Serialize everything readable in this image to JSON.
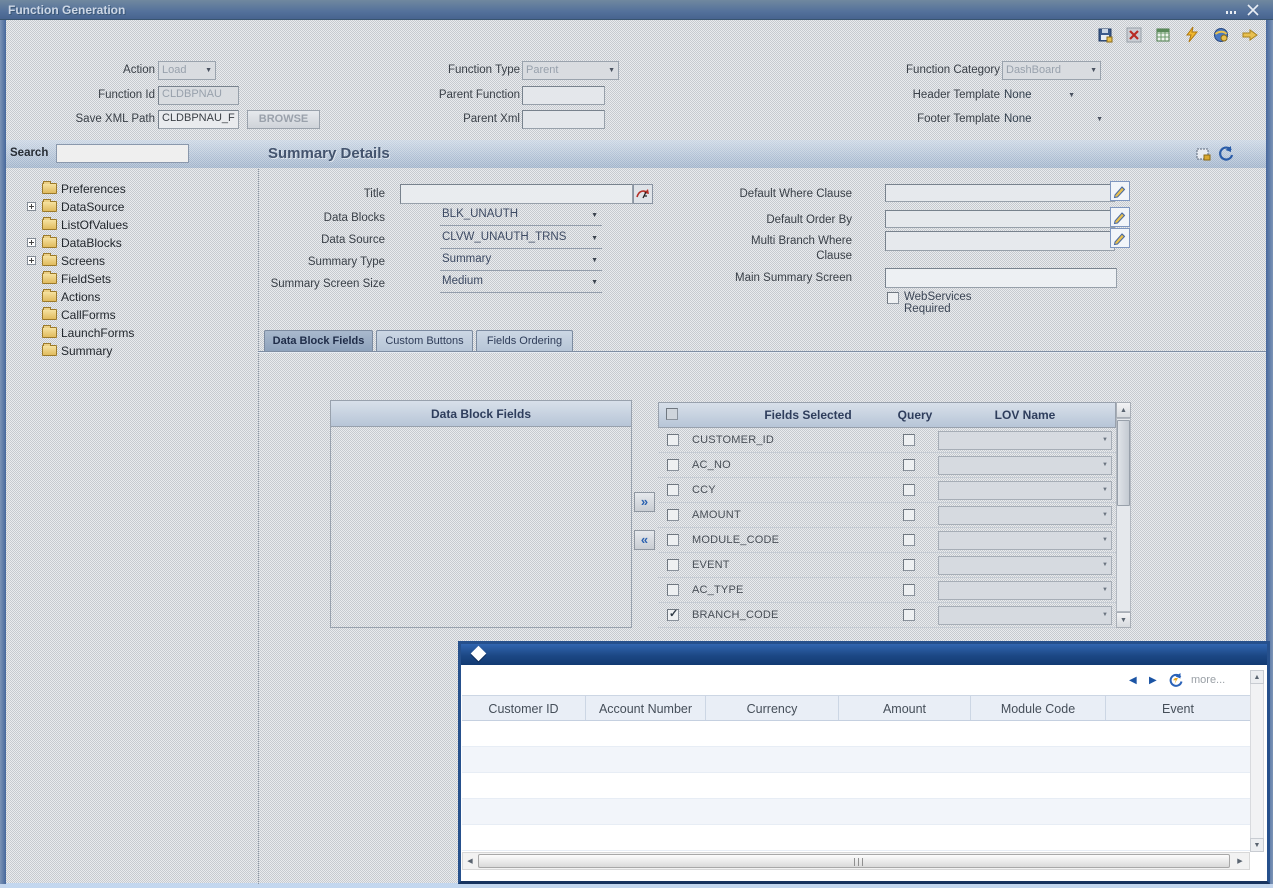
{
  "window": {
    "title": "Function Generation"
  },
  "toolbar": {
    "icon_names": [
      "save-icon",
      "delete-icon",
      "grid-icon",
      "lightning-icon",
      "generate-icon",
      "next-arrow-icon"
    ]
  },
  "header_form": {
    "action": {
      "label": "Action",
      "value": "Load"
    },
    "function_type": {
      "label": "Function Type",
      "value": "Parent"
    },
    "function_category": {
      "label": "Function Category",
      "value": "DashBoard"
    },
    "function_id": {
      "label": "Function Id",
      "value": "CLDBPNAU"
    },
    "parent_function": {
      "label": "Parent Function",
      "value": ""
    },
    "header_template": {
      "label": "Header Template",
      "value": "None"
    },
    "save_xml_path": {
      "label": "Save XML Path",
      "value": "CLDBPNAU_F",
      "browse_label": "BROWSE"
    },
    "parent_xml": {
      "label": "Parent Xml",
      "value": ""
    },
    "footer_template": {
      "label": "Footer Template",
      "value": "None"
    }
  },
  "sidebar": {
    "search_label": "Search",
    "search_value": "",
    "tree": [
      {
        "label": "Preferences"
      },
      {
        "label": "DataSource",
        "expandable": true
      },
      {
        "label": "ListOfValues"
      },
      {
        "label": "DataBlocks",
        "expandable": true
      },
      {
        "label": "Screens",
        "expandable": true
      },
      {
        "label": "FieldSets"
      },
      {
        "label": "Actions"
      },
      {
        "label": "CallForms"
      },
      {
        "label": "LaunchForms"
      },
      {
        "label": "Summary"
      }
    ]
  },
  "main": {
    "title": "Summary Details",
    "form": {
      "title_field": {
        "label": "Title",
        "value": ""
      },
      "data_blocks": {
        "label": "Data Blocks",
        "value": "BLK_UNAUTH"
      },
      "data_source": {
        "label": "Data Source",
        "value": "CLVW_UNAUTH_TRNS"
      },
      "summary_type": {
        "label": "Summary Type",
        "value": "Summary"
      },
      "summary_screen_size": {
        "label": "Summary Screen Size",
        "value": "Medium"
      },
      "default_where": {
        "label": "Default Where Clause",
        "value": ""
      },
      "default_order_by": {
        "label": "Default Order By",
        "value": ""
      },
      "multi_branch_where_1": "Multi Branch Where",
      "multi_branch_where_2": "Clause",
      "multi_branch_value": "",
      "main_summary_screen": {
        "label": "Main Summary Screen",
        "value": ""
      },
      "webservices": {
        "label": "WebServices Required",
        "checked": false
      }
    },
    "tabs": [
      {
        "label": "Data Block Fields",
        "active": true
      },
      {
        "label": "Custom Buttons",
        "active": false
      },
      {
        "label": "Fields Ordering",
        "active": false
      }
    ],
    "fields_panel": {
      "left_title": "Data Block Fields",
      "table": {
        "headers": {
          "fields": "Fields Selected",
          "query": "Query",
          "lov": "LOV Name"
        },
        "rows": [
          {
            "name": "CUSTOMER_ID",
            "checked": false,
            "query": false
          },
          {
            "name": "AC_NO",
            "checked": false,
            "query": false
          },
          {
            "name": "CCY",
            "checked": false,
            "query": false
          },
          {
            "name": "AMOUNT",
            "checked": false,
            "query": false
          },
          {
            "name": "MODULE_CODE",
            "checked": false,
            "query": false
          },
          {
            "name": "EVENT",
            "checked": false,
            "query": false
          },
          {
            "name": "AC_TYPE",
            "checked": false,
            "query": false
          },
          {
            "name": "BRANCH_CODE",
            "checked": true,
            "query": false
          }
        ]
      }
    }
  },
  "preview": {
    "more_label": "more...",
    "columns": [
      "Customer ID",
      "Account Number",
      "Currency",
      "Amount",
      "Module Code",
      "Event"
    ],
    "rows": []
  }
}
